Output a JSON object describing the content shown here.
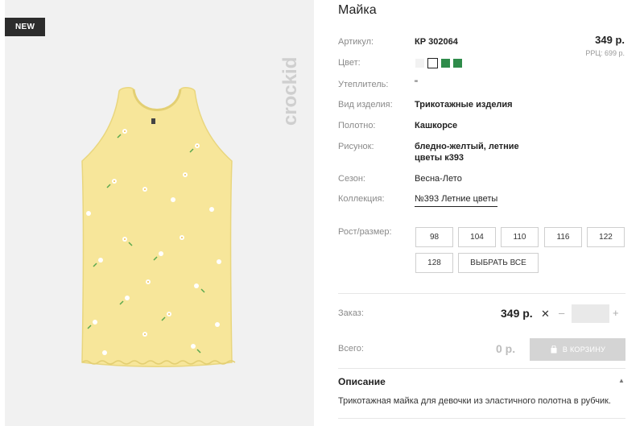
{
  "badge": "NEW",
  "brand": "crockid",
  "product": {
    "title": "Майка",
    "article_label": "Артикул:",
    "article_value": "КР 302064",
    "price": "349 р.",
    "rrp": "РРЦ: 699 р.",
    "color_label": "Цвет:",
    "insulation_label": "Утеплитель:",
    "insulation_value": "\"",
    "type_label": "Вид изделия:",
    "type_value": "Трикотажные изделия",
    "fabric_label": "Полотно:",
    "fabric_value": "Кашкорсе",
    "pattern_label": "Рисунок:",
    "pattern_line1": "бледно-желтый, летние",
    "pattern_line2": "цветы к393",
    "season_label": "Сезон:",
    "season_value": "Весна-Лето",
    "collection_label": "Коллекция:",
    "collection_value": "№393 Летние цветы"
  },
  "colors": [
    "#f2f2f2",
    "#ffffff",
    "#2e8b4a",
    "#2e8b4a"
  ],
  "sizes": {
    "label": "Рост/размер:",
    "options": [
      "98",
      "104",
      "110",
      "116",
      "122",
      "128"
    ],
    "select_all": "ВЫБРАТЬ ВСЕ"
  },
  "order": {
    "label": "Заказ:",
    "price": "349 р.",
    "remove": "✕",
    "minus": "–",
    "plus": "+",
    "quantity": ""
  },
  "total": {
    "label": "Всего:",
    "value": "0 р.",
    "cart_button": "В КОРЗИНУ"
  },
  "description": {
    "title": "Описание",
    "toggle": "▲",
    "text": "Трикотажная майка для девочки из эластичного полотна в рубчик."
  }
}
